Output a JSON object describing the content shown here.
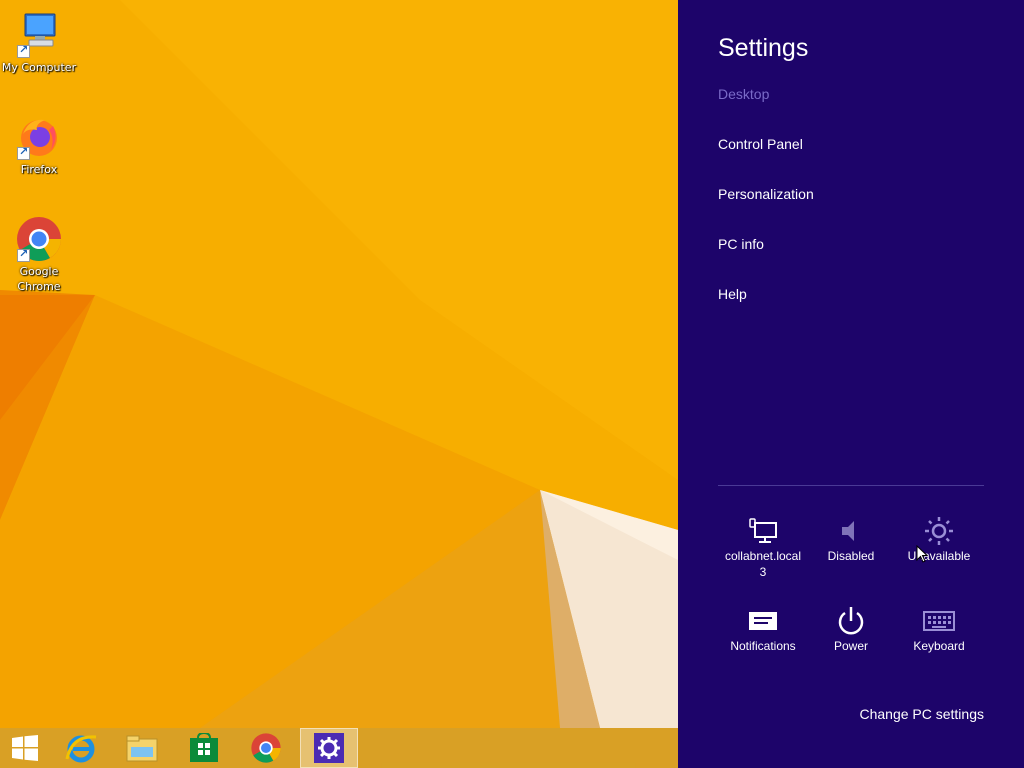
{
  "desktop": {
    "icons": [
      {
        "label": "My Computer",
        "icon": "my-computer-icon"
      },
      {
        "label": "Firefox",
        "icon": "firefox-icon"
      },
      {
        "label_line1": "Google",
        "label_line2": "Chrome",
        "icon": "chrome-icon"
      }
    ]
  },
  "taskbar": {
    "buttons": [
      {
        "icon": "windows-start-icon"
      },
      {
        "icon": "internet-explorer-icon"
      },
      {
        "icon": "file-explorer-icon"
      },
      {
        "icon": "store-icon"
      },
      {
        "icon": "chrome-icon"
      },
      {
        "icon": "settings-gear-icon",
        "active": true
      }
    ]
  },
  "charm": {
    "title": "Settings",
    "context": "Desktop",
    "links": [
      "Control Panel",
      "Personalization",
      "PC info",
      "Help"
    ],
    "quick_settings": [
      {
        "label_line1": "collabnet.local",
        "label_line2": "3",
        "icon": "network-icon"
      },
      {
        "label": "Disabled",
        "icon": "volume-icon"
      },
      {
        "label": "Unavailable",
        "icon": "brightness-icon"
      },
      {
        "label": "Notifications",
        "icon": "notifications-icon"
      },
      {
        "label": "Power",
        "icon": "power-icon"
      },
      {
        "label": "Keyboard",
        "icon": "keyboard-icon"
      }
    ],
    "change_pc_settings": "Change PC settings"
  },
  "colors": {
    "charm_bg": "#1d046a",
    "wallpaper": "#f5a800",
    "dim_text": "#7a6bc8"
  }
}
